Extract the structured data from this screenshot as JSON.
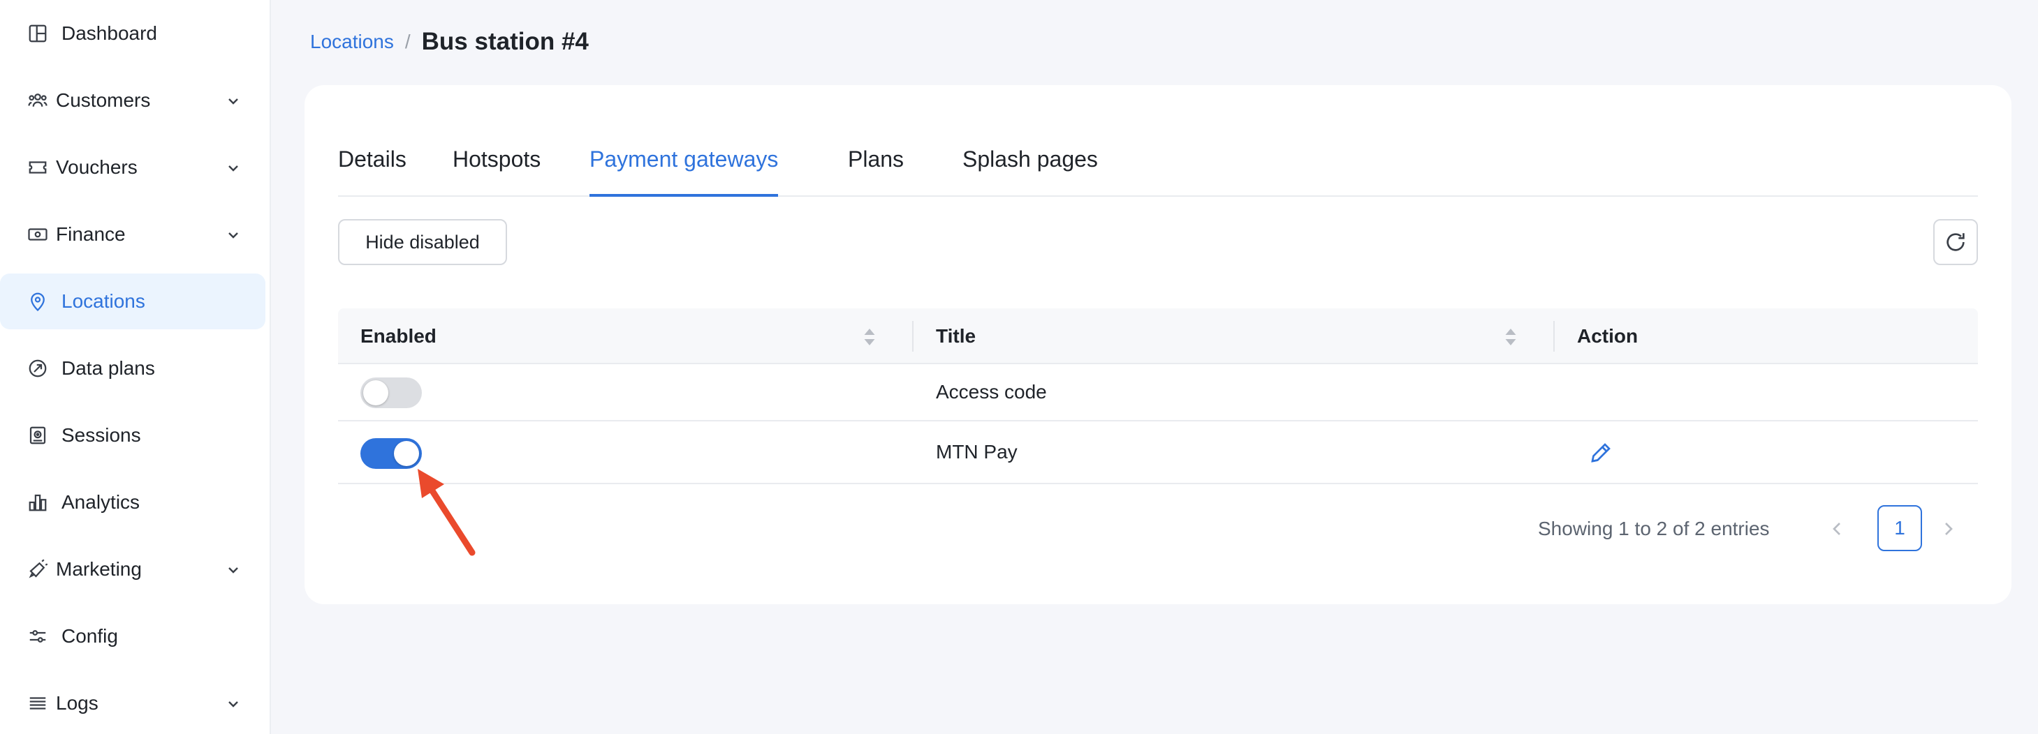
{
  "sidebar": {
    "items": [
      {
        "label": "Dashboard",
        "icon": "dashboard-icon",
        "has_chevron": false,
        "active": false
      },
      {
        "label": "Customers",
        "icon": "customers-icon",
        "has_chevron": true,
        "active": false
      },
      {
        "label": "Vouchers",
        "icon": "voucher-icon",
        "has_chevron": true,
        "active": false
      },
      {
        "label": "Finance",
        "icon": "finance-icon",
        "has_chevron": true,
        "active": false
      },
      {
        "label": "Locations",
        "icon": "location-pin-icon",
        "has_chevron": false,
        "active": true
      },
      {
        "label": "Data plans",
        "icon": "data-plans-icon",
        "has_chevron": false,
        "active": false
      },
      {
        "label": "Sessions",
        "icon": "sessions-icon",
        "has_chevron": false,
        "active": false
      },
      {
        "label": "Analytics",
        "icon": "analytics-icon",
        "has_chevron": false,
        "active": false
      },
      {
        "label": "Marketing",
        "icon": "megaphone-icon",
        "has_chevron": true,
        "active": false
      },
      {
        "label": "Config",
        "icon": "sliders-icon",
        "has_chevron": false,
        "active": false
      },
      {
        "label": "Logs",
        "icon": "list-icon",
        "has_chevron": true,
        "active": false
      }
    ]
  },
  "breadcrumb": {
    "parent": "Locations",
    "separator": "/",
    "current": "Bus station #4"
  },
  "tabs": [
    {
      "label": "Details",
      "active": false
    },
    {
      "label": "Hotspots",
      "active": false
    },
    {
      "label": "Payment gateways",
      "active": true
    },
    {
      "label": "Plans",
      "active": false
    },
    {
      "label": "Splash pages",
      "active": false
    }
  ],
  "toolbar": {
    "hide_disabled_label": "Hide disabled",
    "refresh_icon": "refresh-icon"
  },
  "table": {
    "columns": [
      "Enabled",
      "Title",
      "Action"
    ],
    "rows": [
      {
        "enabled": false,
        "title": "Access code",
        "has_edit": false
      },
      {
        "enabled": true,
        "title": "MTN Pay",
        "has_edit": true
      }
    ]
  },
  "pagination": {
    "info": "Showing 1 to 2 of 2 entries",
    "current_page": "1"
  },
  "colors": {
    "accent": "#2f73dc",
    "annotation_arrow": "#ea4a2c",
    "active_nav_bg": "#ebf4fe"
  }
}
